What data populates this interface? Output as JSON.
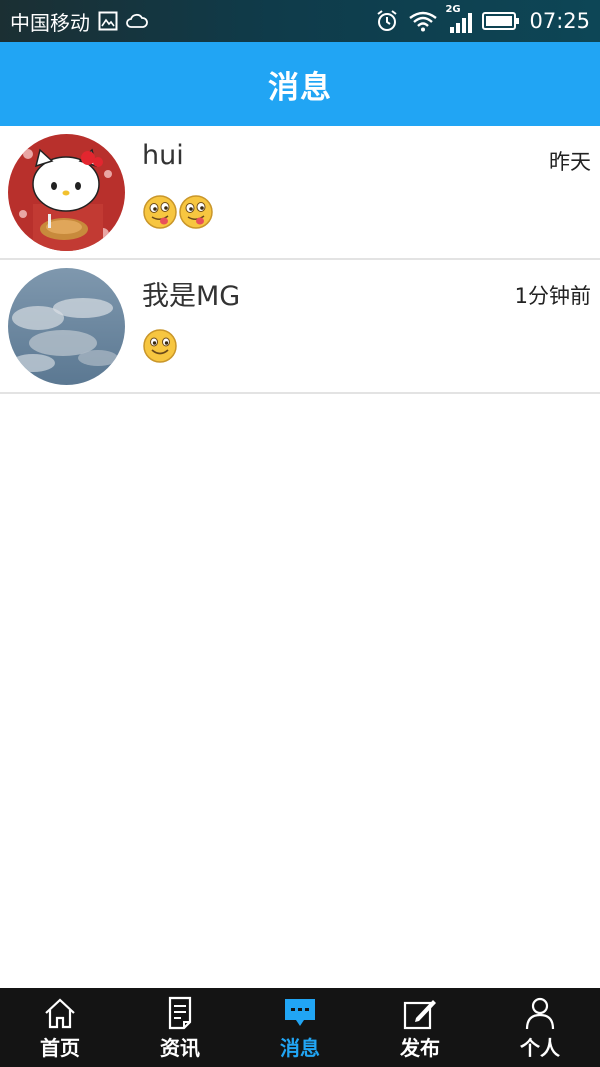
{
  "status_bar": {
    "carrier": "中国移动",
    "network": "2G",
    "time": "07:25",
    "icons": [
      "gallery-icon",
      "cloud-icon",
      "alarm-icon",
      "wifi-icon",
      "signal-icon",
      "battery-icon"
    ]
  },
  "header": {
    "title": "消息"
  },
  "conversations": [
    {
      "name": "hui",
      "time": "昨天",
      "avatar": "hello-kitty-avatar",
      "preview_emojis": [
        "tongue-out-emoji",
        "tongue-out-emoji"
      ]
    },
    {
      "name": "我是MG",
      "time": "1分钟前",
      "avatar": "sky-clouds-avatar",
      "preview_emojis": [
        "smile-emoji"
      ]
    }
  ],
  "bottom_nav": {
    "active": "消息",
    "items": [
      {
        "label": "首页",
        "icon": "home-icon"
      },
      {
        "label": "资讯",
        "icon": "news-icon"
      },
      {
        "label": "消息",
        "icon": "message-icon"
      },
      {
        "label": "发布",
        "icon": "edit-icon"
      },
      {
        "label": "个人",
        "icon": "person-icon"
      }
    ]
  },
  "colors": {
    "accent": "#21a5f4",
    "nav_background": "#141414",
    "divider": "#e3e3e3"
  }
}
